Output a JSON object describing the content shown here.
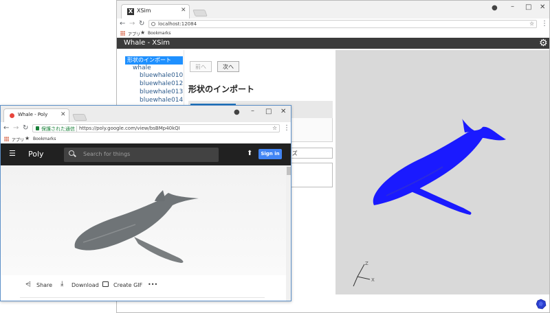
{
  "xsim_window": {
    "tab_title": "XSim",
    "address": "localhost:12084",
    "bookmarks": {
      "apps": "アプリ",
      "bookmarks": "Bookmarks"
    },
    "header_title": "Whale - XSim",
    "tree": {
      "selected": "形状のインポート",
      "root": "whale",
      "children": [
        "bluewhale010",
        "bluewhale012",
        "bluewhale013",
        "bluewhale014"
      ]
    },
    "prev_label": "前へ",
    "next_label": "次へ",
    "section_title": "形状のインポート",
    "size_label": "イズ",
    "axes": {
      "x": "X",
      "z": "Z"
    },
    "colors": {
      "whale": "#1a1aff",
      "viewport": "#d9d9d9",
      "header": "#3b3b3b"
    }
  },
  "poly_window": {
    "tab_title": "Whale - Poly",
    "secure_label": "保護された通信",
    "url": "https://poly.google.com/view/bsBMp40kQI",
    "bookmarks": {
      "apps": "アプリ",
      "bookmarks": "Bookmarks"
    },
    "brand": "Poly",
    "search_placeholder": "Search for things",
    "signin_label": "Sign in",
    "actions": {
      "share": "Share",
      "download": "Download",
      "create_gif": "Create GIF",
      "more": "•••"
    },
    "colors": {
      "header": "#212121",
      "signin": "#4285f4"
    }
  }
}
